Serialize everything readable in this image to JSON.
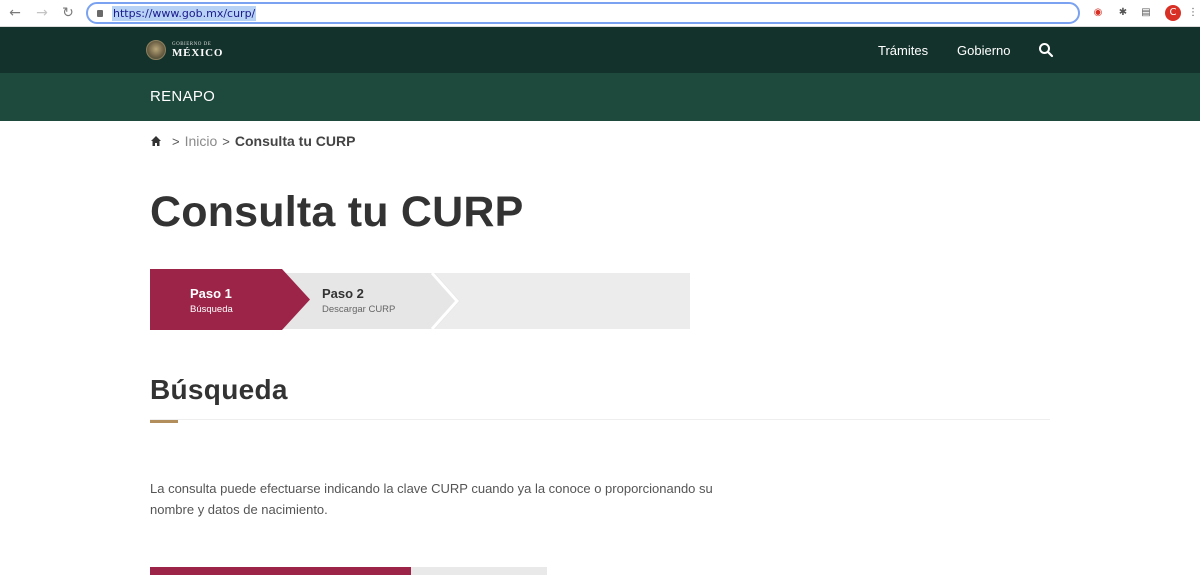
{
  "browser": {
    "url": "https://www.gob.mx/curp/",
    "colors": {
      "extension_red": "#d93025"
    }
  },
  "header": {
    "logo": {
      "small_text": "GOBIERNO DE",
      "big_text": "MÉXICO"
    },
    "nav": [
      "Trámites",
      "Gobierno"
    ],
    "search_icon": "search-icon",
    "colors": {
      "top_bar": "#13322b",
      "sub_bar": "#1e4a3d"
    }
  },
  "subheader": {
    "title": "RENAPO"
  },
  "breadcrumb": {
    "home_icon": "home-icon",
    "separator": ">",
    "items": [
      "Inicio",
      "Consulta tu CURP"
    ]
  },
  "page": {
    "title": "Consulta tu CURP"
  },
  "stepper": {
    "steps": [
      {
        "title": "Paso 1",
        "subtitle": "Búsqueda",
        "state": "active"
      },
      {
        "title": "Paso 2",
        "subtitle": "Descargar CURP",
        "state": "inactive"
      }
    ],
    "colors": {
      "active": "#9d2449",
      "inactive": "#ececec"
    }
  },
  "section": {
    "title": "Búsqueda",
    "description": "La consulta puede efectuarse indicando la clave CURP cuando ya la conoce o proporcionando su nombre y datos de nacimiento.",
    "colors": {
      "accent": "#b38e5d"
    }
  }
}
